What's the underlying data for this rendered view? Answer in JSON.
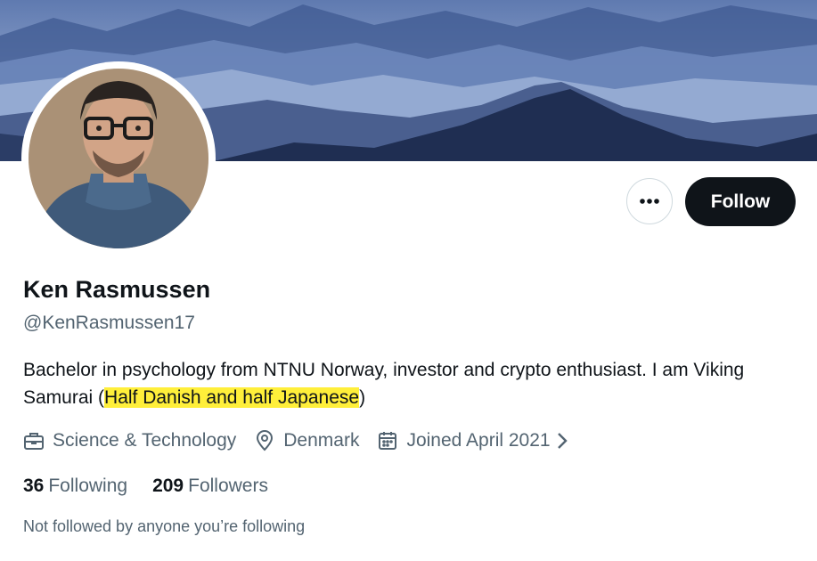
{
  "colors": {
    "text_primary": "#0f1419",
    "text_secondary": "#536471",
    "highlight": "#ffef3a",
    "follow_button_bg": "#0f1419",
    "banner_sky": "#8fa6cf",
    "banner_mountains": "#1f2e52"
  },
  "profile": {
    "display_name": "Ken Rasmussen",
    "handle": "@KenRasmussen17",
    "bio_plain": "Bachelor in psychology from NTNU Norway, investor and crypto enthusiast. I am Viking Samurai (",
    "bio_highlight": "Half Danish and half Japanese",
    "bio_end": ")"
  },
  "actions": {
    "more_icon": "ellipsis-icon",
    "follow_label": "Follow"
  },
  "meta": {
    "category": {
      "icon": "briefcase-icon",
      "label": "Science & Technology"
    },
    "location": {
      "icon": "location-pin-icon",
      "label": "Denmark"
    },
    "joined": {
      "icon": "calendar-icon",
      "label": "Joined April 2021"
    }
  },
  "stats": {
    "following_count": "36",
    "following_label": "Following",
    "followers_count": "209",
    "followers_label": "Followers"
  },
  "social_context": "Not followed by anyone you’re following"
}
